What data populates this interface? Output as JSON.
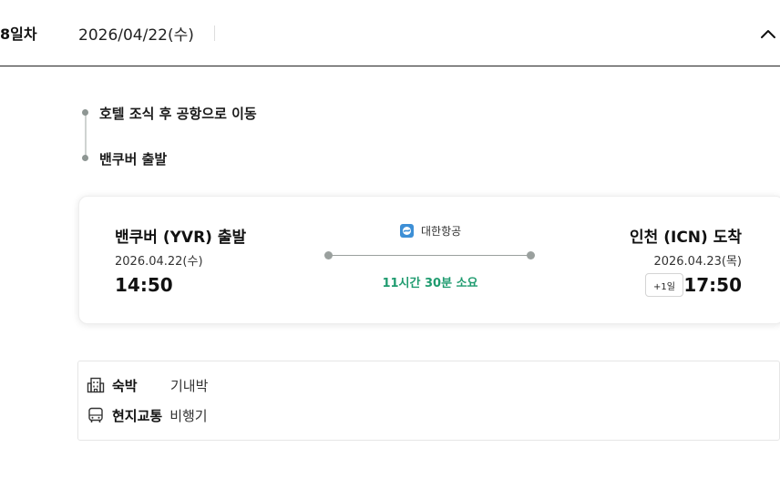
{
  "header": {
    "day": "8일차",
    "date": "2026/04/22(수)",
    "collapse_icon": "chevron-up-icon"
  },
  "timeline": {
    "items": [
      {
        "text": "호텔 조식 후 공항으로 이동"
      },
      {
        "text": "밴쿠버 출발"
      }
    ]
  },
  "flight": {
    "departure": {
      "title": "밴쿠버 (YVR) 출발",
      "date": "2026.04.22(수)",
      "time": "14:50"
    },
    "airline": {
      "name": "대한항공",
      "logo_icon": "korean-air-logo-icon",
      "logo_color": "#3d8fd6"
    },
    "duration": "11시간 30분 소요",
    "duration_color": "#1f9b6f",
    "arrival": {
      "title": "인천 (ICN) 도착",
      "date": "2026.04.23(목)",
      "day_offset": "+1일",
      "time": "17:50"
    }
  },
  "info": {
    "lodging": {
      "icon": "building-icon",
      "label": "숙박",
      "value": "기내박"
    },
    "transport": {
      "icon": "bus-icon",
      "label": "현지교통",
      "value": "비행기"
    }
  }
}
